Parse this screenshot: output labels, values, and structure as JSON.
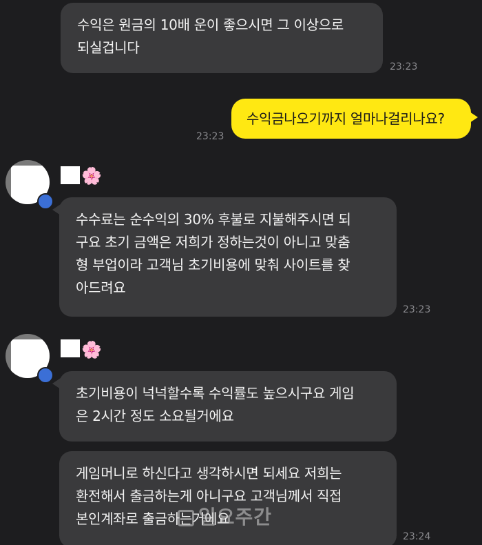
{
  "messages": [
    {
      "sender": "theirs",
      "lines": [
        "수익은 원금의 10배 운이 좋으시면 그 이상으로",
        "되실겁니다"
      ],
      "time": "23:23"
    },
    {
      "sender": "mine",
      "lines": [
        "수익금나오기까지 얼마나걸리나요?"
      ],
      "time": "23:23"
    },
    {
      "sender": "theirs",
      "name_emoji": "🌸",
      "lines": [
        "수수료는 순수익의 30% 후불로 지불해주시면 되",
        "구요 초기 금액은 저희가 정하는것이 아니고 맞춤",
        "형 부업이라 고객님 초기비용에 맞춰 사이트를 찾",
        "아드려요"
      ],
      "time": "23:23"
    },
    {
      "sender": "theirs",
      "name_emoji": "🌸",
      "lines": [
        "초기비용이 넉넉할수록 수익률도 높으시구요 게임",
        "은 2시간 정도 소요될거에요"
      ]
    },
    {
      "sender": "theirs",
      "lines": [
        "게임머니로 하신다고 생각하시면 되세요 저희는",
        "환전해서 출금하는게 아니구요 고객님께서 직접",
        "본인계좌로 출금하는거에요"
      ],
      "time": "23:24"
    }
  ],
  "watermark": "일요주간",
  "colors": {
    "background": "#1d1d1f",
    "their_bubble": "#3a3a3c",
    "my_bubble": "#ffe812",
    "time_text": "#8a8a8e"
  }
}
